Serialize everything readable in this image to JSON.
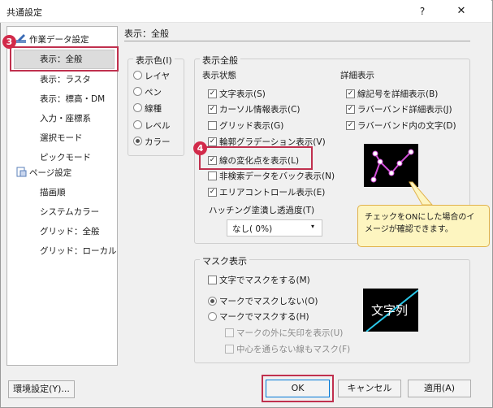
{
  "window": {
    "title": "共通設定",
    "help": "?",
    "close": "✕"
  },
  "tree": {
    "items": [
      {
        "label": "作業データ設定"
      },
      {
        "label": "表示：全般"
      },
      {
        "label": "表示：ラスタ"
      },
      {
        "label": "表示：標高・DM"
      },
      {
        "label": "入力・座標系"
      },
      {
        "label": "選択モード"
      },
      {
        "label": "ピックモード"
      },
      {
        "label": "ページ設定"
      },
      {
        "label": "描画順"
      },
      {
        "label": "システムカラー"
      },
      {
        "label": "グリッド：全般"
      },
      {
        "label": "グリッド：ローカル"
      }
    ]
  },
  "badges": {
    "b3": "3",
    "b4": "4"
  },
  "panel": {
    "title": "表示：全般"
  },
  "color_group": {
    "title": "表示色(I)",
    "options": [
      "レイヤ",
      "ペン",
      "線種",
      "レベル",
      "カラー"
    ],
    "selected": "カラー"
  },
  "main_group": {
    "title": "表示全般",
    "status_heading": "表示状態",
    "detail_heading": "詳細表示",
    "status_items": [
      {
        "label": "文字表示(S)",
        "checked": true
      },
      {
        "label": "カーソル情報表示(C)",
        "checked": true
      },
      {
        "label": "グリッド表示(G)",
        "checked": false
      },
      {
        "label": "輪郭グラデーション表示(V)",
        "checked": true
      },
      {
        "label": "線の変化点を表示(L)",
        "checked": true
      },
      {
        "label": "非検索データをバック表示(N)",
        "checked": false
      },
      {
        "label": "エリアコントロール表示(E)",
        "checked": true
      }
    ],
    "detail_items": [
      {
        "label": "線記号を詳細表示(B)",
        "checked": true
      },
      {
        "label": "ラバーバンド詳細表示(J)",
        "checked": true
      },
      {
        "label": "ラバーバンド内の文字(D)",
        "checked": true
      }
    ],
    "hatching_label": "ハッチング塗潰し透過度(T)",
    "hatching_value": "なし( 0%)"
  },
  "callout": {
    "text": "チェックをONにした場合のイメージが確認できます。"
  },
  "mask_group": {
    "title": "マスク表示",
    "text_mask": {
      "label": "文字でマスクをする(M)",
      "checked": false
    },
    "radio_options": [
      {
        "label": "マークでマスクしない(O)",
        "selected": true
      },
      {
        "label": "マークでマスクする(H)",
        "selected": false
      }
    ],
    "sub_options": [
      {
        "label": "マークの外に矢印を表示(U)",
        "checked": false
      },
      {
        "label": "中心を通らない線もマスク(F)",
        "checked": false
      }
    ],
    "preview_text": "文字列"
  },
  "buttons": {
    "env": "環境設定(Y)...",
    "ok": "OK",
    "cancel": "キャンセル",
    "apply": "適用(A)"
  }
}
